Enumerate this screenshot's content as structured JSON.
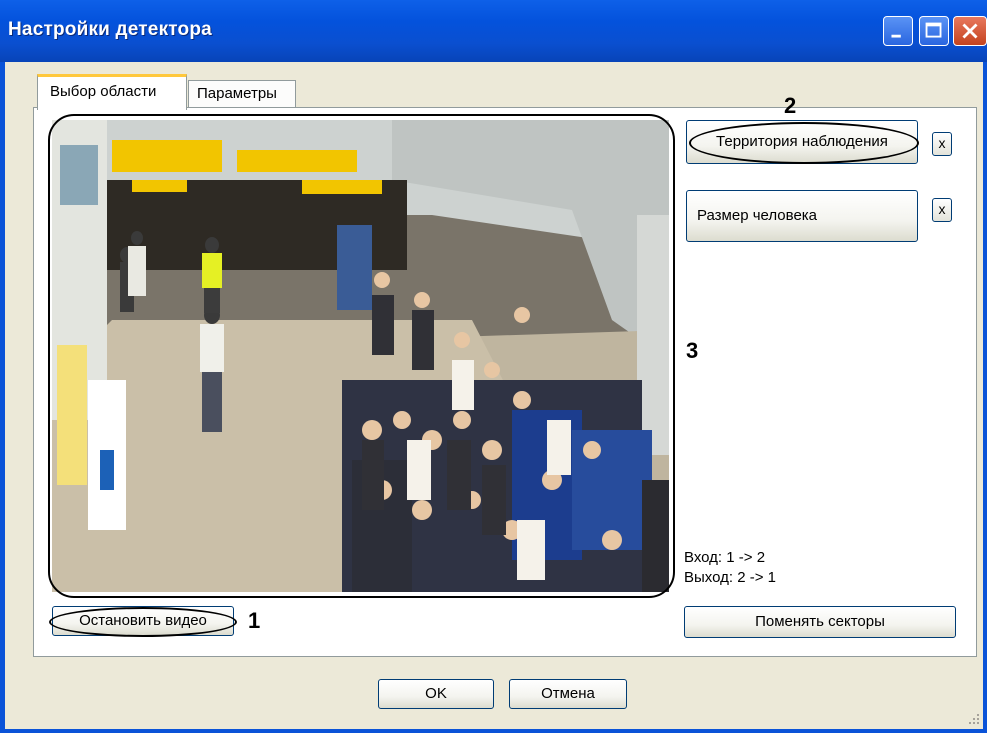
{
  "window": {
    "title": "Настройки детектора"
  },
  "tabs": [
    {
      "label": "Выбор области"
    },
    {
      "label": "Параметры"
    }
  ],
  "area_buttons": {
    "territory_label": "Территория наблюдения",
    "person_size_label": "Размер человека",
    "delete_label": "x"
  },
  "rules": {
    "entry": "Вход: 1 -> 2",
    "exit": "Выход: 2 -> 1"
  },
  "buttons": {
    "stop_video": "Остановить видео",
    "swap_sectors": "Поменять секторы",
    "ok": "OK",
    "cancel": "Отмена"
  },
  "callouts": {
    "one": "1",
    "two": "2",
    "three": "3"
  },
  "colors": {
    "titlebar": "#0a53d8",
    "client": "#ece9d8",
    "tab_highlight": "#ffc83c",
    "close_button": "#d5542c"
  }
}
